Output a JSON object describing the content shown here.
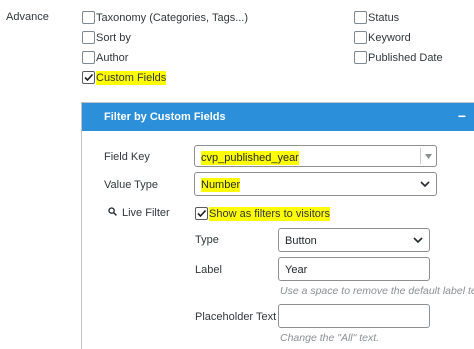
{
  "section_label": "Advance",
  "options": {
    "taxonomy": {
      "label": "Taxonomy (Categories, Tags...)",
      "checked": false
    },
    "sort_by": {
      "label": "Sort by",
      "checked": false
    },
    "author": {
      "label": "Author",
      "checked": false
    },
    "custom_fields": {
      "label": "Custom Fields",
      "checked": true
    },
    "status": {
      "label": "Status",
      "checked": false
    },
    "keyword": {
      "label": "Keyword",
      "checked": false
    },
    "published_date": {
      "label": "Published Date",
      "checked": false
    }
  },
  "panel": {
    "title": "Filter by Custom Fields",
    "collapse_symbol": "−",
    "field_key_label": "Field Key",
    "field_key_value": "cvp_published_year",
    "value_type_label": "Value Type",
    "value_type_value": "Number",
    "live_filter_label": "Live Filter",
    "show_as_filters_label": "Show as filters to visitors",
    "show_as_filters_checked": true,
    "type_label": "Type",
    "type_value": "Button",
    "label_label": "Label",
    "label_value": "Year",
    "label_hint": "Use a space to remove the default label text.",
    "placeholder_label": "Placeholder Text",
    "placeholder_value": "",
    "placeholder_hint": "Change the \"All\" text."
  },
  "colors": {
    "accent": "#2b8fd9",
    "highlight": "#ffff00"
  }
}
